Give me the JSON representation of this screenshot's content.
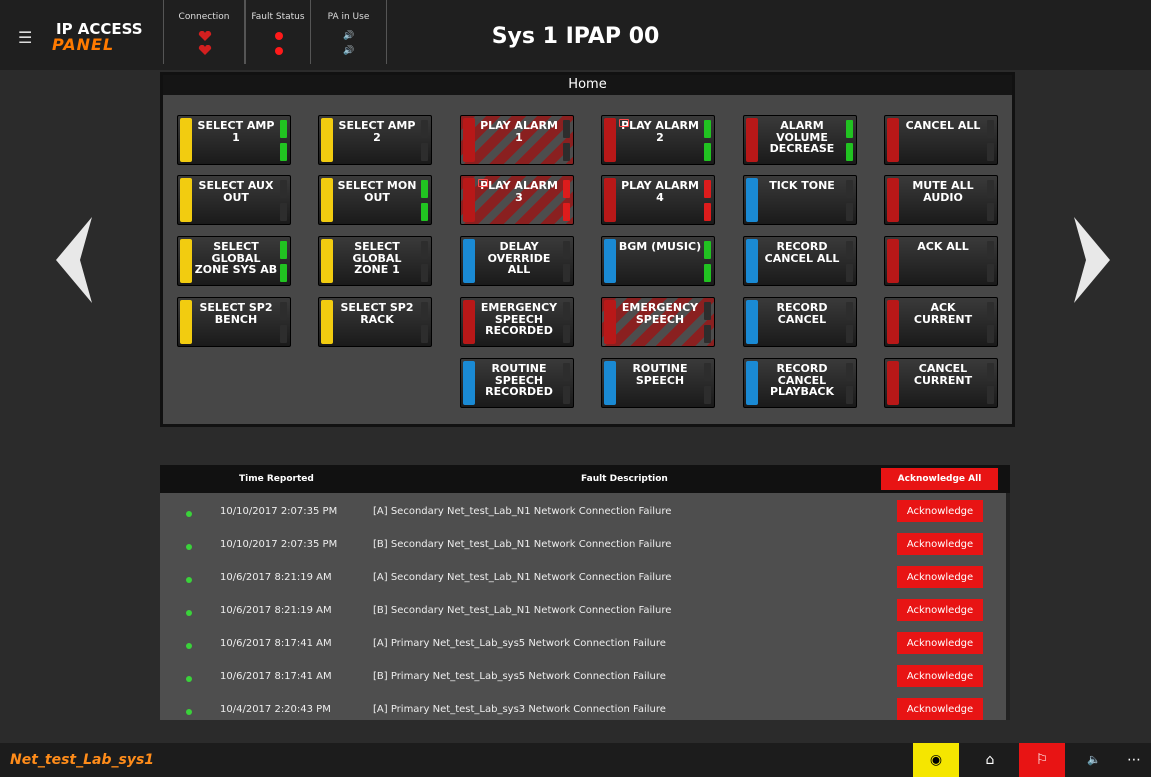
{
  "header": {
    "app_logo_line1": "IP ACCESS",
    "app_logo_line2": "PANEL",
    "title": "Sys 1 IPAP 00",
    "status_groups": [
      "Connection",
      "Fault Status",
      "PA in Use"
    ]
  },
  "home": {
    "title": "Home",
    "buttons": [
      {
        "label": "SELECT AMP 1",
        "color": "#f2cc10"
      },
      {
        "label": "SELECT AMP 2",
        "color": "#f2cc10"
      },
      {
        "label": "PLAY ALARM 1",
        "color": "#b81818"
      },
      {
        "label": "PLAY ALARM 2",
        "color": "#b81818"
      },
      {
        "label": "ALARM VOLUME DECREASE",
        "color": "#b81818"
      },
      {
        "label": "CANCEL ALL",
        "color": "#b81818"
      },
      {
        "label": "SELECT AUX OUT",
        "color": "#f2cc10"
      },
      {
        "label": "SELECT MON OUT",
        "color": "#f2cc10"
      },
      {
        "label": "PLAY ALARM 3",
        "color": "#b81818"
      },
      {
        "label": "PLAY ALARM 4",
        "color": "#b81818"
      },
      {
        "label": "TICK TONE",
        "color": "#1a8ad4"
      },
      {
        "label": "MUTE ALL AUDIO",
        "color": "#b81818"
      },
      {
        "label": "SELECT GLOBAL ZONE SYS AB",
        "color": "#f2cc10"
      },
      {
        "label": "SELECT GLOBAL ZONE 1",
        "color": "#f2cc10"
      },
      {
        "label": "DELAY OVERRIDE ALL",
        "color": "#1a8ad4"
      },
      {
        "label": "BGM (MUSIC)",
        "color": "#1a8ad4"
      },
      {
        "label": "RECORD CANCEL ALL",
        "color": "#1a8ad4"
      },
      {
        "label": "ACK ALL",
        "color": "#b81818"
      },
      {
        "label": "SELECT SP2 BENCH",
        "color": "#f2cc10"
      },
      {
        "label": "SELECT SP2 RACK",
        "color": "#f2cc10"
      },
      {
        "label": "EMERGENCY SPEECH RECORDED",
        "color": "#b81818"
      },
      {
        "label": "EMERGENCY SPEECH",
        "color": "#b81818"
      },
      {
        "label": "RECORD CANCEL",
        "color": "#1a8ad4"
      },
      {
        "label": "ACK CURRENT",
        "color": "#b81818"
      },
      {
        "label": "ROUTINE SPEECH RECORDED",
        "color": "#1a8ad4"
      },
      {
        "label": "ROUTINE SPEECH",
        "color": "#1a8ad4"
      },
      {
        "label": "RECORD CANCEL PLAYBACK",
        "color": "#1a8ad4"
      },
      {
        "label": "CANCEL CURRENT",
        "color": "#b81818"
      }
    ]
  },
  "faults": {
    "col_time": "Time Reported",
    "col_desc": "Fault Description",
    "ack_all_label": "Acknowledge All",
    "ack_label": "Acknowledge",
    "rows": [
      {
        "time": "10/10/2017 2:07:35 PM",
        "desc": "[A] Secondary Net_test_Lab_N1 Network Connection Failure"
      },
      {
        "time": "10/10/2017 2:07:35 PM",
        "desc": "[B] Secondary Net_test_Lab_N1 Network Connection Failure"
      },
      {
        "time": "10/6/2017 8:21:19 AM",
        "desc": "[A] Secondary Net_test_Lab_N1 Network Connection Failure"
      },
      {
        "time": "10/6/2017 8:21:19 AM",
        "desc": "[B] Secondary Net_test_Lab_N1 Network Connection Failure"
      },
      {
        "time": "10/6/2017 8:17:41 AM",
        "desc": "[A] Primary Net_test_Lab_sys5 Network Connection Failure"
      },
      {
        "time": "10/6/2017 8:17:41 AM",
        "desc": "[B] Primary Net_test_Lab_sys5 Network Connection Failure"
      },
      {
        "time": "10/4/2017 2:20:43 PM",
        "desc": "[A] Primary Net_test_Lab_sys3 Network Connection Failure"
      }
    ]
  },
  "footer": {
    "system_name": "Net_test_Lab_sys1",
    "icons": [
      "record-icon",
      "home-icon",
      "flag-icon",
      "speaker-icon",
      "more-icon"
    ],
    "colors": {
      "record_bg": "#f5e600",
      "flag_bg": "#e81414"
    }
  }
}
